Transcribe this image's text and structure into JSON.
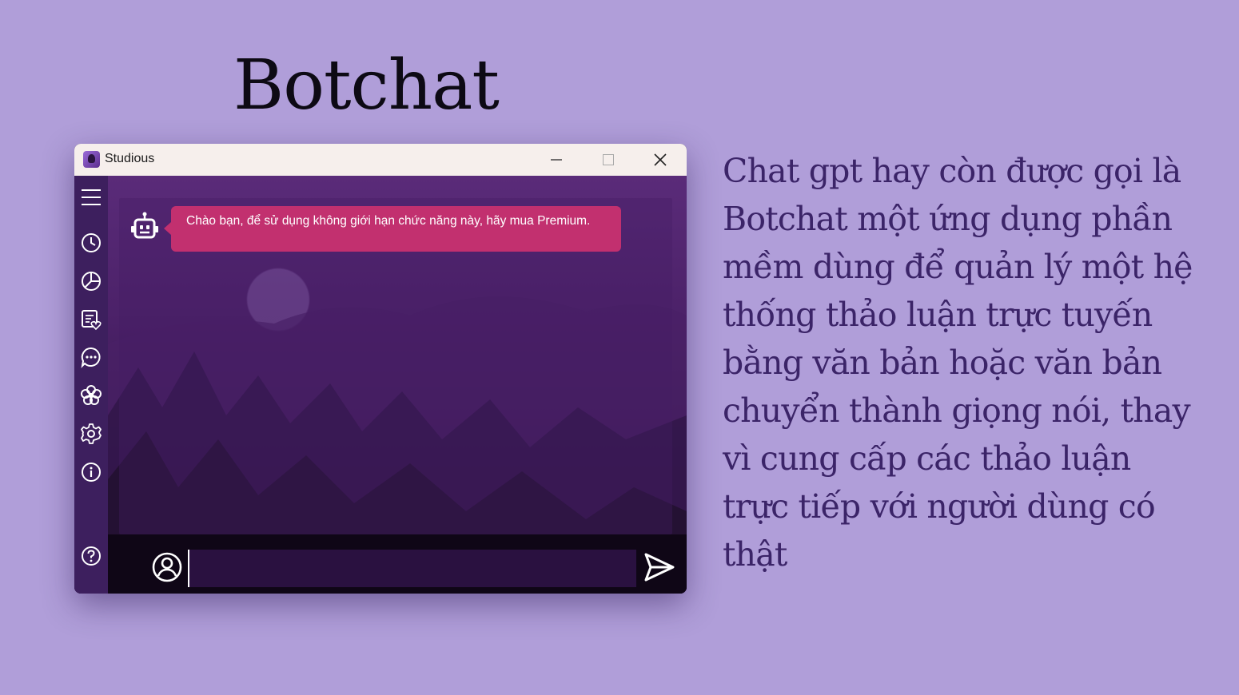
{
  "slide": {
    "title": "Botchat",
    "description": "Chat gpt hay còn được gọi là Botchat một ứng dụng phần mềm dùng để quản lý một hệ thống thảo luận trực tuyến bằng văn bản hoặc văn bản chuyển thành giọng nói, thay vì cung cấp các thảo luận trực tiếp với người dùng có thật"
  },
  "window": {
    "app_name": "Studious",
    "controls": [
      "minimize-icon",
      "maximize-icon",
      "close-icon"
    ]
  },
  "sidebar": {
    "items": [
      {
        "icon": "hamburger-menu-icon"
      },
      {
        "icon": "clock-icon"
      },
      {
        "icon": "pie-chart-icon"
      },
      {
        "icon": "task-list-icon"
      },
      {
        "icon": "chat-bubble-icon"
      },
      {
        "icon": "flower-icon"
      },
      {
        "icon": "gear-icon"
      },
      {
        "icon": "info-icon"
      },
      {
        "icon": "help-icon"
      }
    ]
  },
  "chat": {
    "messages": [
      {
        "sender_icon": "robot-icon",
        "text": "Chào bạn, để sử dụng không giới hạn chức năng này, hãy mua Premium."
      }
    ],
    "input_value": "",
    "user_icon": "user-circle-icon",
    "send_icon": "send-arrow-icon"
  },
  "colors": {
    "background": "#b09ed9",
    "bubble": "#c2306f",
    "sidebar": "#3d1f5e",
    "description_text": "#3b2468"
  }
}
